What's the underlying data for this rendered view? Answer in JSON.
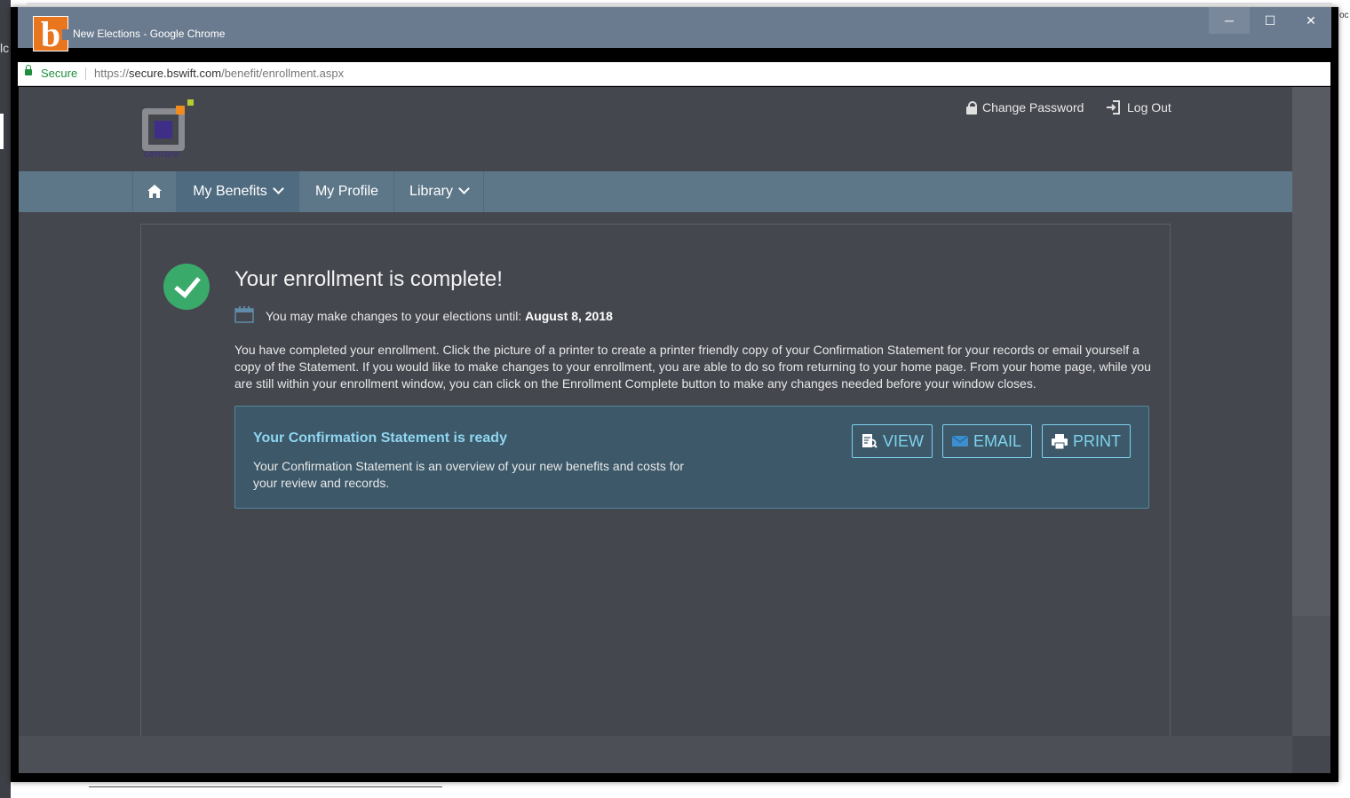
{
  "window": {
    "title": "New Elections - Google Chrome",
    "app_logo_letter": "b",
    "controls": {
      "minimize": "─",
      "maximize": "☐",
      "close": "✕"
    }
  },
  "background": {
    "left_text": "lc",
    "right_text": "oc"
  },
  "addressbar": {
    "secure_label": "Secure",
    "url_scheme": "https://",
    "url_host": "secure.bswift.com",
    "url_path": "/benefit/enrollment.aspx"
  },
  "header": {
    "logo_text": "centare",
    "change_password_label": "Change Password",
    "log_out_label": "Log Out"
  },
  "nav": {
    "home_icon": "home-icon",
    "items": [
      {
        "label": "My Benefits",
        "dropdown": true,
        "active": true
      },
      {
        "label": "My Profile",
        "dropdown": false,
        "active": false
      },
      {
        "label": "Library",
        "dropdown": true,
        "active": false
      }
    ]
  },
  "main": {
    "headline": "Your enrollment is complete!",
    "until_text": "You may make changes to your elections until:",
    "until_date": "August 8, 2018",
    "paragraph": "You have completed your enrollment. Click the picture of a printer to create a printer friendly copy of your Confirmation Statement for your records or email yourself a copy of the Statement. If you would like to make changes to your enrollment, you are able to do so from returning to your home page. From your home page, while you are still within your enrollment window, you can click on the Enrollment Complete button to make any changes needed before your window closes.",
    "confirmation": {
      "title": "Your Confirmation Statement is ready",
      "description": "Your Confirmation Statement is an overview of your new benefits and costs for your review and records.",
      "buttons": {
        "view": "VIEW",
        "email": "EMAIL",
        "print": "PRINT"
      }
    }
  },
  "colors": {
    "nav_bg": "#5d7789",
    "page_bg": "#45474f",
    "accent_cyan": "#7fd3ee",
    "success_green": "#3aaa6a"
  }
}
